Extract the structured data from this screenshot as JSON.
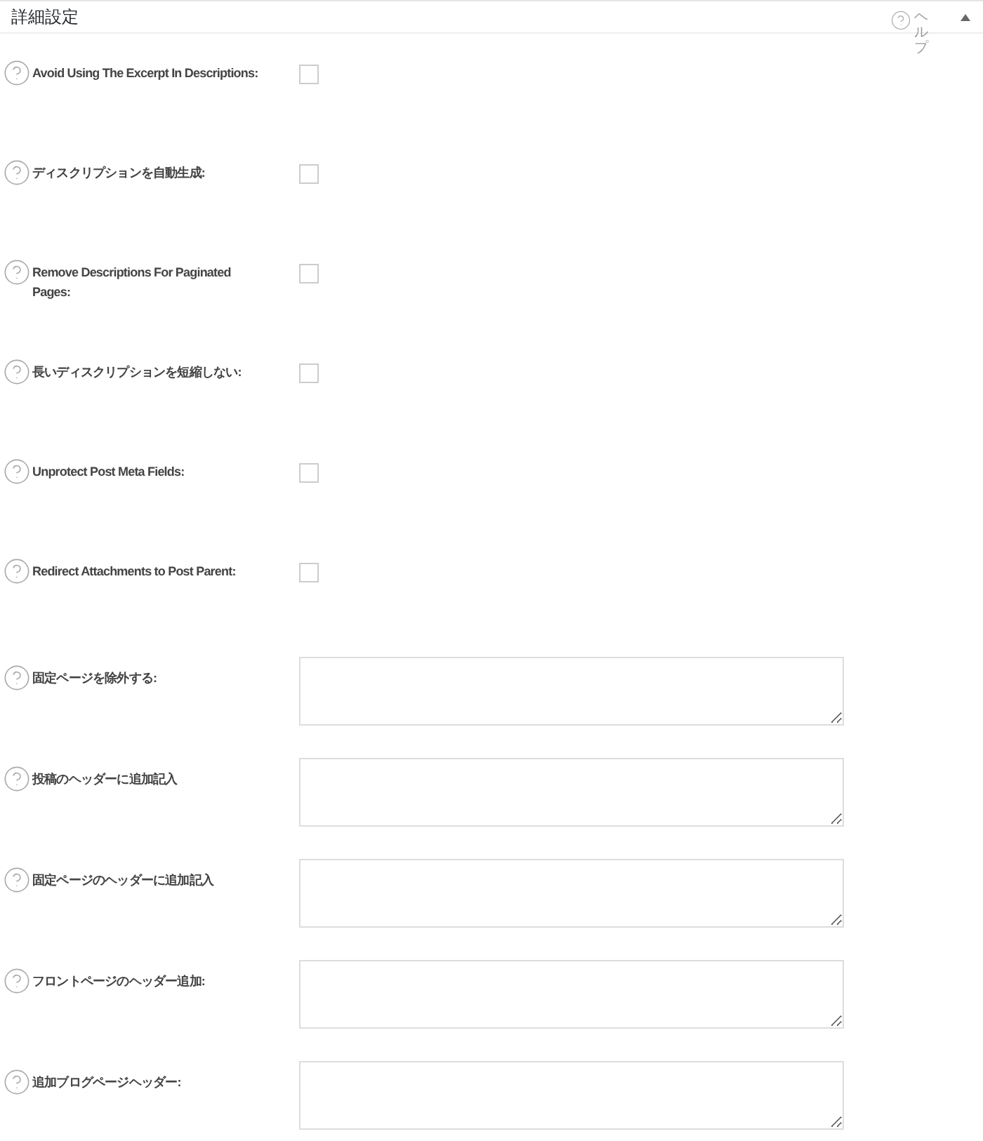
{
  "panel": {
    "title": "詳細設定",
    "help": "ヘルプ",
    "expanded": true
  },
  "settings": [
    {
      "kind": "checkbox",
      "label": "Avoid Using The Excerpt In Descriptions:",
      "checked": false
    },
    {
      "kind": "checkbox",
      "label": "ディスクリプションを自動生成:",
      "checked": false
    },
    {
      "kind": "checkbox",
      "label": "Remove Descriptions For Paginated Pages:",
      "checked": false
    },
    {
      "kind": "checkbox",
      "label": "長いディスクリプションを短縮しない:",
      "checked": false
    },
    {
      "kind": "checkbox",
      "label": "Unprotect Post Meta Fields:",
      "checked": false
    },
    {
      "kind": "checkbox",
      "label": "Redirect Attachments to Post Parent:",
      "checked": false
    },
    {
      "kind": "textarea",
      "label": "固定ページを除外する:"
    },
    {
      "kind": "textarea",
      "label": "投稿のヘッダーに追加記入"
    },
    {
      "kind": "textarea",
      "label": "固定ページのヘッダーに追加記入"
    },
    {
      "kind": "textarea",
      "label": "フロントページのヘッダー追加:"
    },
    {
      "kind": "textarea",
      "label": "追加ブログページヘッダー:"
    }
  ]
}
